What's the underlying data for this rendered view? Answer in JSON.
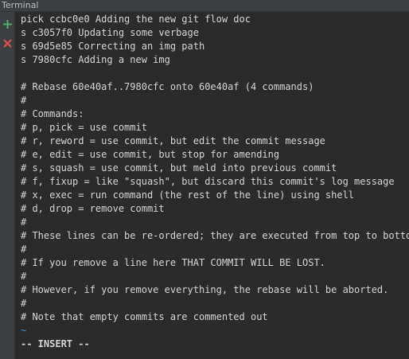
{
  "window": {
    "title": "Terminal"
  },
  "gutter": {
    "add_icon": "plus-icon",
    "close_icon": "close-icon",
    "add_color": "#59a869",
    "close_color": "#d9534f"
  },
  "terminal": {
    "lines": [
      "pick ccbc0e0 Adding the new git flow doc",
      "s c3057f0 Updating some verbage",
      "s 69d5e85 Correcting an img path",
      "s 7980cfc Adding a new img",
      "",
      "# Rebase 60e40af..7980cfc onto 60e40af (4 commands)",
      "#",
      "# Commands:",
      "# p, pick = use commit",
      "# r, reword = use commit, but edit the commit message",
      "# e, edit = use commit, but stop for amending",
      "# s, squash = use commit, but meld into previous commit",
      "# f, fixup = like \"squash\", but discard this commit's log message",
      "# x, exec = run command (the rest of the line) using shell",
      "# d, drop = remove commit",
      "#",
      "# These lines can be re-ordered; they are executed from top to bottom.",
      "#",
      "# If you remove a line here THAT COMMIT WILL BE LOST.",
      "#",
      "# However, if you remove everything, the rebase will be aborted.",
      "#",
      "# Note that empty commits are commented out",
      "~",
      "-- INSERT --"
    ]
  }
}
